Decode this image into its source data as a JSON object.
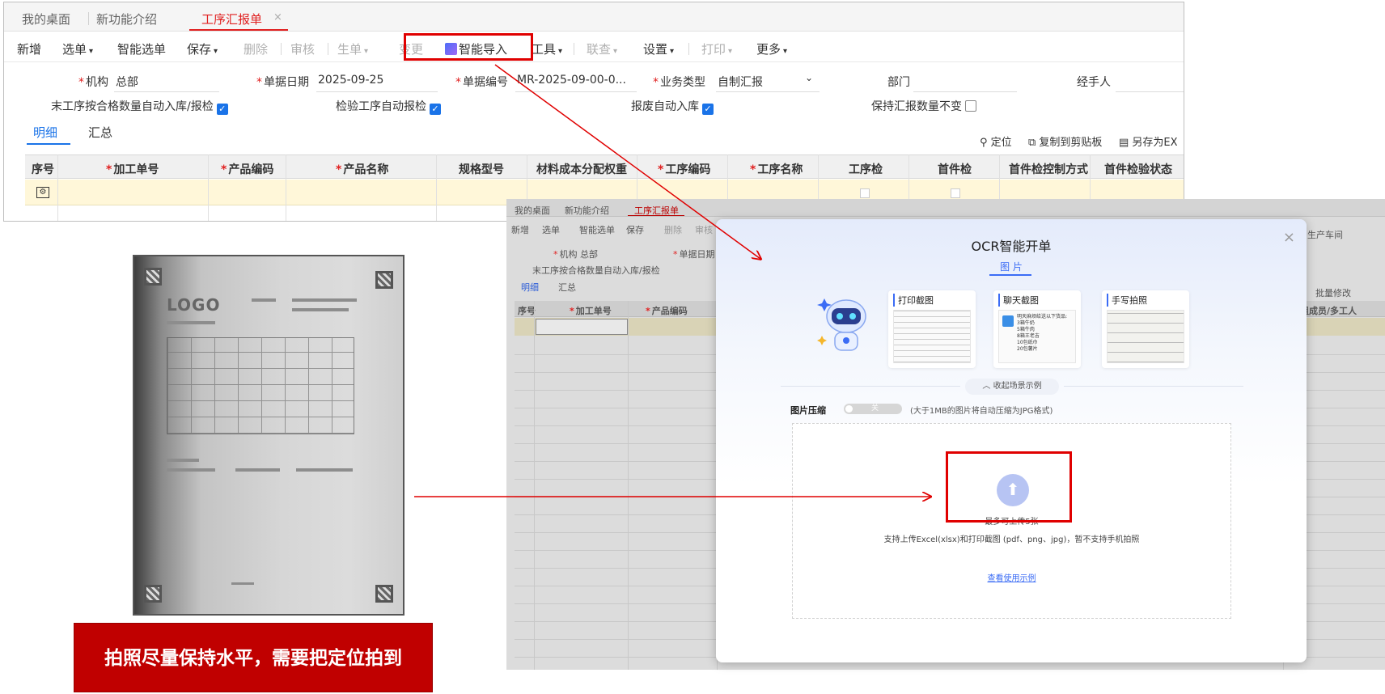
{
  "top": {
    "tabs": [
      "我的桌面",
      "新功能介绍",
      "工序汇报单"
    ],
    "close": "×",
    "toolbar": {
      "add": "新增",
      "select_doc": "选单",
      "smart_select": "智能选单",
      "save": "保存",
      "delete": "删除",
      "audit": "审核",
      "generate": "生单",
      "change": "变更",
      "smart_import": "智能导入",
      "tools": "工具",
      "linked": "联查",
      "settings": "设置",
      "print": "打印",
      "more": "更多"
    },
    "form": {
      "org_label": "机构",
      "org_value": "总部",
      "date_label": "单据日期",
      "date_value": "2025-09-25",
      "no_label": "单据编号",
      "no_value": "MR-2025-09-00-0...",
      "biz_label": "业务类型",
      "biz_value": "自制汇报",
      "dept_label": "部门",
      "handler_label": "经手人",
      "opt1": "末工序按合格数量自动入库/报检",
      "opt2": "检验工序自动报检",
      "opt3": "报废自动入库",
      "opt4": "保持汇报数量不变"
    },
    "subtabs": [
      "明细",
      "汇总"
    ],
    "tools_right": [
      "定位",
      "复制到剪贴板",
      "另存为EX"
    ],
    "columns": [
      "序号",
      "加工单号",
      "产品编码",
      "产品名称",
      "规格型号",
      "材料成本分配权重",
      "工序编码",
      "工序名称",
      "工序检",
      "首件检",
      "首件检控制方式",
      "首件检验状态"
    ]
  },
  "photo": {
    "logo": "LOGO"
  },
  "caption": "拍照尽量保持水平，需要把定位拍到",
  "bg": {
    "tabs": [
      "我的桌面",
      "新功能介绍",
      "工序汇报单"
    ],
    "toolbar": [
      "新增",
      "选单",
      "智能选单",
      "保存",
      "删除",
      "审核"
    ],
    "org_label": "机构",
    "org_value": "总部",
    "date_label": "单据日期",
    "opt1": "末工序按合格数量自动入库/报检",
    "subtabs": [
      "明细",
      "汇总"
    ],
    "columns": [
      "序号",
      "加工单号",
      "产品编码"
    ],
    "right_tools": "批量修改",
    "right_col": "班组成员/多工人",
    "right_top": "生产车间"
  },
  "modal": {
    "title": "OCR智能开单",
    "tab": "图 片",
    "cards": [
      {
        "title": "打印截图"
      },
      {
        "title": "聊天截图",
        "lines": [
          "明天麻烦给送以下货品:",
          "3箱牛奶",
          "5箱牛肉",
          "8箱王老吉",
          "10包纸巾",
          "20包薯片"
        ]
      },
      {
        "title": "手写拍照"
      }
    ],
    "collapse": "收起场景示例",
    "compress_label": "图片压缩",
    "toggle_text": "关",
    "compress_hint": "(大于1MB的图片将自动压缩为JPG格式)",
    "upload_limit": "最多可上传5张",
    "support": "支持上传Excel(xlsx)和打印截图 (pdf、png、jpg)，暂不支持手机拍照",
    "example_link": "查看使用示例",
    "close": "×"
  },
  "colors": {
    "accent_red": "#e00000",
    "brand_blue": "#3b6cf5",
    "caption_bg": "#c00000"
  }
}
